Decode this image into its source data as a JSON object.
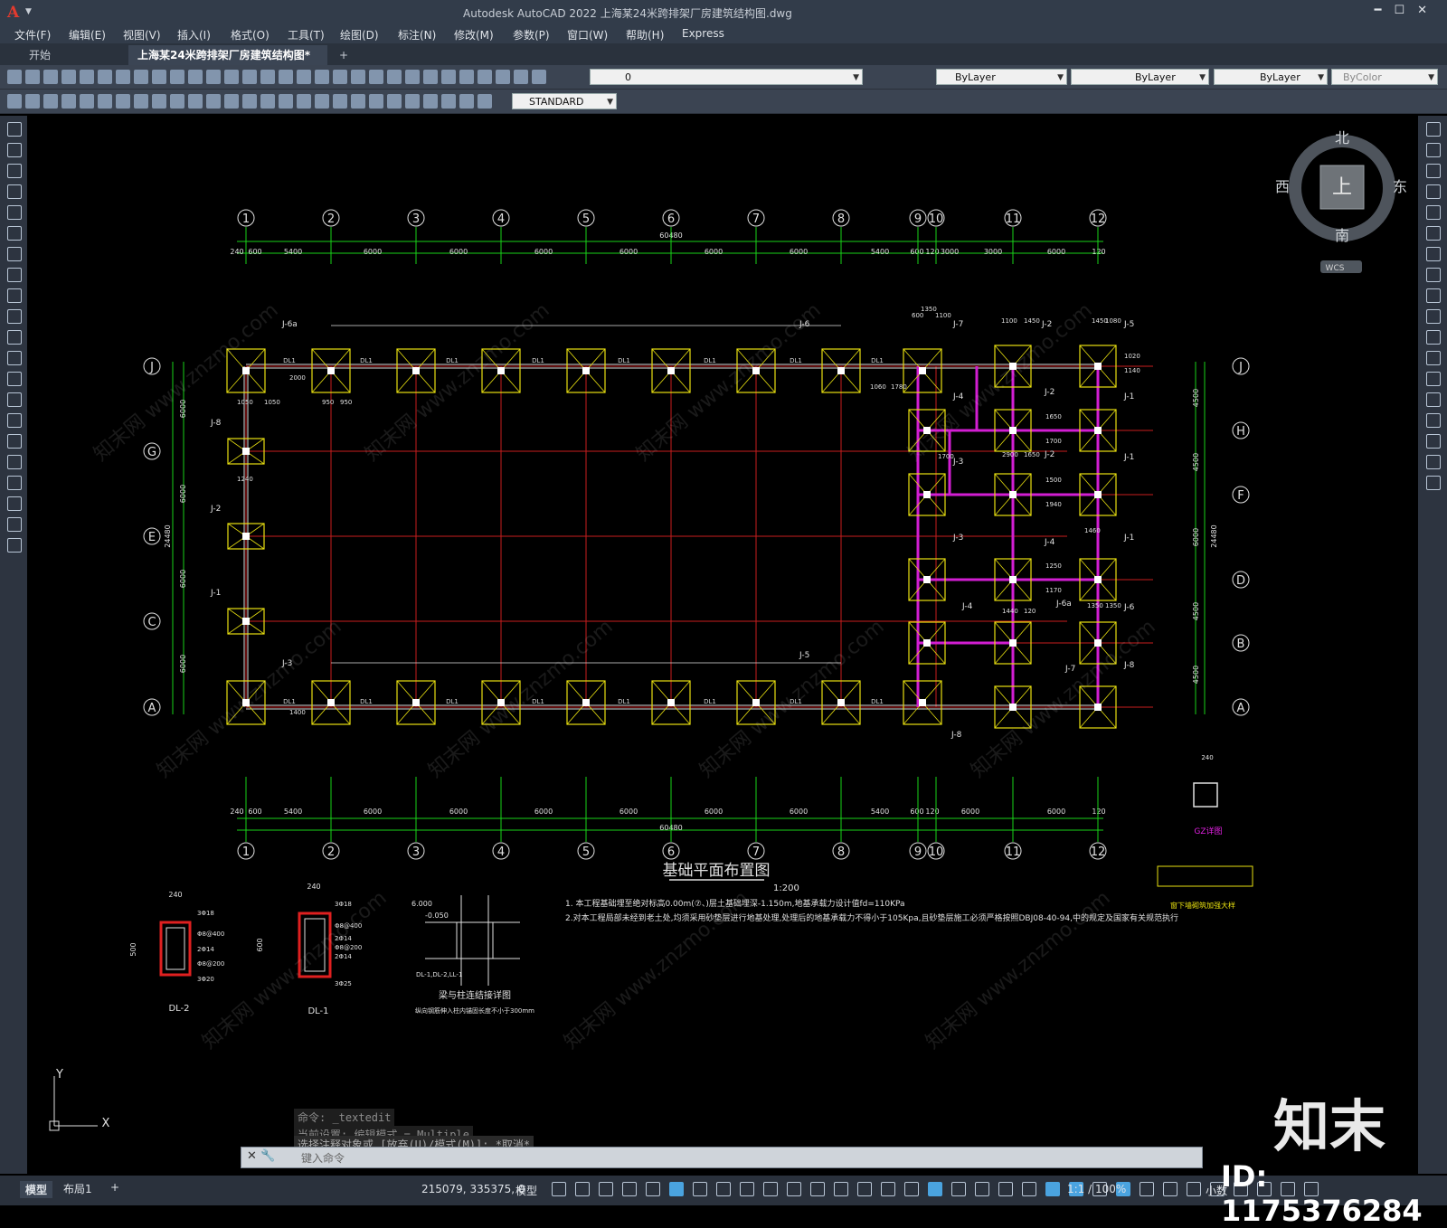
{
  "app": {
    "title": "Autodesk AutoCAD 2022    上海某24米跨排架厂房建筑结构图.dwg"
  },
  "menu": [
    "文件(F)",
    "编辑(E)",
    "视图(V)",
    "插入(I)",
    "格式(O)",
    "工具(T)",
    "绘图(D)",
    "标注(N)",
    "修改(M)",
    "参数(P)",
    "窗口(W)",
    "帮助(H)",
    "Express"
  ],
  "tabs": {
    "start": "开始",
    "doc": "上海某24米跨排架厂房建筑结构图*",
    "close": "✕",
    "add": "+"
  },
  "toolbar": {
    "layer_value": "0",
    "color": "ByLayer",
    "linetype": "ByLayer",
    "lineweight": "ByLayer",
    "plotstyle": "ByColor",
    "textstyle": "STANDARD"
  },
  "viewcube": {
    "north": "北",
    "south": "南",
    "east": "东",
    "west": "西",
    "top": "上",
    "wcs": "WCS"
  },
  "drawing": {
    "plan_title": "基础平面布置图",
    "plan_scale": "1:200",
    "axis_numbers": [
      "1",
      "2",
      "3",
      "4",
      "5",
      "6",
      "7",
      "8",
      "9",
      "10",
      "11",
      "12"
    ],
    "axis_letters_left": [
      "J",
      "G",
      "E",
      "C",
      "A"
    ],
    "axis_letters_right": [
      "J",
      "H",
      "F",
      "D",
      "B",
      "A"
    ],
    "dims_top": [
      "240",
      "600",
      "5400",
      "6000",
      "6000",
      "6000",
      "6000",
      "6000",
      "6000",
      "5400",
      "600",
      "120",
      "3000",
      "3000",
      "6000",
      "120"
    ],
    "dim_total_top": "60480",
    "dims_bottom": [
      "240",
      "600",
      "5400",
      "6000",
      "6000",
      "6000",
      "6000",
      "6000",
      "6000",
      "5400",
      "600",
      "120",
      "6000",
      "6000",
      "120"
    ],
    "dim_total_bottom": "60480",
    "dims_left": [
      "6000",
      "6000",
      "6000",
      "6000"
    ],
    "dim_total_left": "24480",
    "dims_right": [
      "4500",
      "4500",
      "6000",
      "4500",
      "4500"
    ],
    "dim_total_right": "24480",
    "footing_labels": [
      "J-6a",
      "J-6",
      "J-7",
      "J-2",
      "J-5",
      "J-8",
      "J-2",
      "J-1",
      "J-4",
      "J-2",
      "J-1",
      "J-3",
      "J-2",
      "J-1",
      "J-3",
      "J-4",
      "J-1",
      "J-4",
      "J-6a",
      "J-6",
      "J-3",
      "J-5",
      "J-7",
      "J-8",
      "J-8"
    ],
    "beam_label": "DL1",
    "notes": [
      "1. 本工程基础埋至绝对标高0.00m(⑦、)层土基础埋深-1.150m,地基承载力设计值fd=110KPa",
      "2.对本工程局部未经到老土处,均须采用砂垫层进行地基处理,处理后的地基承载力不得小于105Kpa,且砂垫层施工必须严格按照DBJ08-40-94,中的规定及国家有关规范执行"
    ],
    "sections": {
      "dl2": {
        "name": "DL-2",
        "width": "240",
        "height": "500",
        "bars": [
          "3Φ18",
          "Φ8@400",
          "2Φ14",
          "Φ8@200",
          "3Φ20"
        ]
      },
      "dl1": {
        "name": "DL-1",
        "width": "240",
        "height": "600",
        "bars": [
          "3Φ18",
          "Φ8@400",
          "Φ8@200",
          "2Φ14",
          "2Φ14",
          "3Φ25"
        ]
      },
      "detail": {
        "title": "梁与柱连结接详图",
        "note": "DL-1,DL-2,LL-1",
        "note2": "纵向钢筋伸入柱内锚固长度不小于300mm",
        "elev1": "-0.050",
        "elev2": "6.000"
      },
      "gz": {
        "name": "GZ详图",
        "w": "240"
      },
      "wall": {
        "name": "窗下墙砌筑加强大样"
      }
    },
    "small_dims": [
      "1050",
      "1050",
      "950",
      "950",
      "2000",
      "1400",
      "1240",
      "1350",
      "600",
      "1100",
      "1100",
      "1450",
      "1450",
      "1080",
      "1020",
      "1140",
      "1060",
      "1780",
      "2900",
      "1650",
      "1650",
      "1700",
      "1700",
      "1500",
      "1940",
      "1460",
      "1250",
      "1170",
      "1350",
      "1350",
      "1440",
      "120"
    ]
  },
  "command": {
    "history": [
      "命令: _textedit",
      "当前设置: 编辑模式 = Multiple",
      "选择注释对象或 [放弃(U)/模式(M)]: *取消*"
    ],
    "placeholder": "键入命令"
  },
  "layout_tabs": [
    "模型",
    "布局1",
    "+"
  ],
  "status": {
    "coords": "215079, 335375, 0",
    "model": "模型",
    "scale": "1:1 / 100%",
    "units": "小数"
  },
  "watermark": {
    "id": "ID: 1175376284",
    "logo": "知末",
    "site": "知末网 www.znzmo.com"
  },
  "ucs": {
    "x": "X",
    "y": "Y"
  }
}
